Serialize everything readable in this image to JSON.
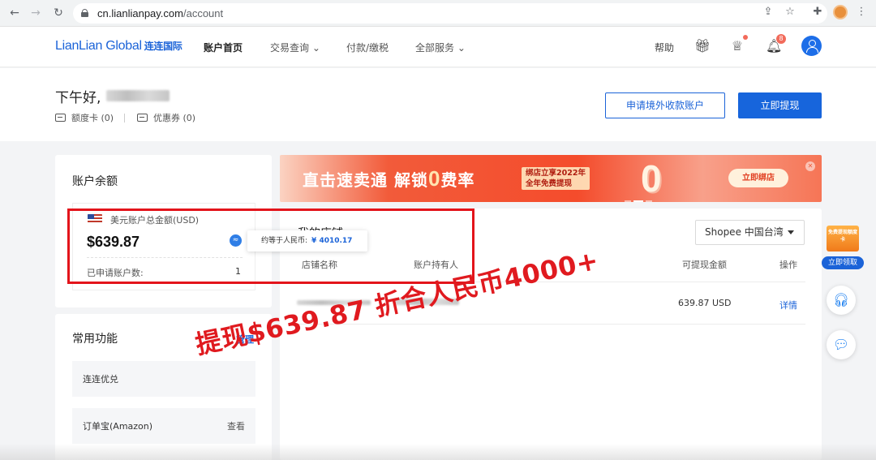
{
  "browser": {
    "url_host": "cn.lianlianpay.com",
    "url_path": "/account",
    "back_icon": "arrow-left-icon",
    "forward_icon": "arrow-right-icon",
    "reload_icon": "reload-icon"
  },
  "header": {
    "logo_text": "LianLian Global",
    "logo_cn": "连连国际",
    "nav": [
      {
        "label": "账户首页"
      },
      {
        "label": "交易查询"
      },
      {
        "label": "付款/缴税"
      },
      {
        "label": "全部服务"
      }
    ],
    "help_label": "帮助",
    "notification_count": "8"
  },
  "greeting": {
    "title": "下午好,",
    "quota_card": "额度卡 (0)",
    "coupon": "优惠券 (0)",
    "apply_button": "申请境外收款账户",
    "withdraw_button": "立即提现"
  },
  "balance": {
    "title": "账户余额",
    "currency_label": "美元账户总金额(USD)",
    "amount": "$639.87",
    "accounts_label": "已申请账户数:",
    "accounts_count": "1",
    "tooltip_label": "约等于人民币:",
    "tooltip_value": "¥ 4010.17"
  },
  "functions": {
    "title": "常用功能",
    "manage_label": "管理",
    "items": [
      {
        "label": "连连优兑",
        "action": ""
      },
      {
        "label": "订单宝(Amazon)",
        "action": "查看"
      }
    ]
  },
  "banner": {
    "headline_a": "直击速卖通 解锁",
    "headline_zero": "0",
    "headline_b": "费率",
    "sub_line1": "绑店立享2022年",
    "sub_line2": "全年免费提现",
    "big_zero": "0",
    "cta": "立即绑店"
  },
  "store": {
    "title": "我的店铺",
    "selected_region": "Shopee 中国台湾",
    "columns": [
      "店铺名称",
      "账户持有人",
      "可提现金额",
      "操作"
    ],
    "rows": [
      {
        "amount": "639.87 USD",
        "action": "详情"
      }
    ]
  },
  "floating": {
    "promo_badge": "免费提现额度卡",
    "promo_button": "立即领取"
  },
  "annotation": {
    "text": "提现$639.87 折合人民币4000+"
  },
  "colors": {
    "brand": "#1b63d8",
    "annotation_red": "#e01a1f",
    "banner_red": "#f44c2c"
  }
}
